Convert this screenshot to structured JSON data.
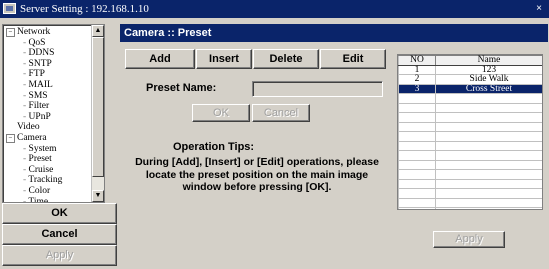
{
  "window": {
    "title": "Server Setting : 192.168.1.10",
    "close": "×"
  },
  "tree": {
    "items": [
      {
        "label": "Network",
        "level": 0,
        "expander": "−"
      },
      {
        "label": "QoS",
        "level": 1
      },
      {
        "label": "DDNS",
        "level": 1
      },
      {
        "label": "SNTP",
        "level": 1
      },
      {
        "label": "FTP",
        "level": 1
      },
      {
        "label": "MAIL",
        "level": 1
      },
      {
        "label": "SMS",
        "level": 1
      },
      {
        "label": "Filter",
        "level": 1
      },
      {
        "label": "UPnP",
        "level": 1
      },
      {
        "label": "Video",
        "level": 0
      },
      {
        "label": "Camera",
        "level": 0,
        "expander": "−"
      },
      {
        "label": "System",
        "level": 1
      },
      {
        "label": "Preset",
        "level": 1
      },
      {
        "label": "Cruise",
        "level": 1
      },
      {
        "label": "Tracking",
        "level": 1
      },
      {
        "label": "Color",
        "level": 1
      },
      {
        "label": "Time",
        "level": 1
      }
    ]
  },
  "left_buttons": {
    "ok": "OK",
    "cancel": "Cancel",
    "apply": "Apply"
  },
  "section": {
    "title": "Camera :: Preset"
  },
  "toolbar": {
    "add": "Add",
    "insert": "Insert",
    "delete": "Delete",
    "edit": "Edit"
  },
  "form": {
    "preset_name_label": "Preset Name:",
    "preset_name_value": "",
    "ok": "OK",
    "cancel": "Cancel"
  },
  "tips": {
    "title": "Operation Tips:",
    "text": "During [Add], [Insert] or [Edit] operations, please locate the preset position on the main image window before pressing [OK]."
  },
  "presets": {
    "columns": [
      "NO",
      "Name"
    ],
    "rows": [
      {
        "no": "1",
        "name": "123"
      },
      {
        "no": "2",
        "name": "Side Walk"
      },
      {
        "no": "3",
        "name": "Cross Street",
        "selected": true
      }
    ],
    "empty_rows": 15
  },
  "apply_button": "Apply",
  "colors": {
    "titlebar": "#0a246a",
    "face": "#d4d0c8",
    "selection": "#0a246a"
  }
}
